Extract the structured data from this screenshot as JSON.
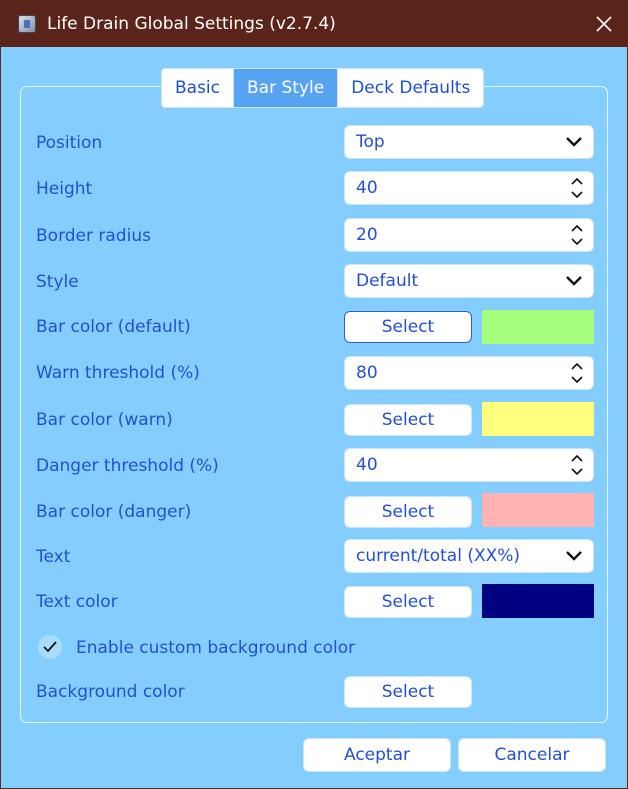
{
  "window": {
    "title": "Life Drain Global Settings (v2.7.4)",
    "icon": "app-icon",
    "close_icon": "close-icon",
    "titlebar_color": "#5b241b",
    "background_color": "#84ceff"
  },
  "tabs": [
    {
      "label": "Basic",
      "active": false
    },
    {
      "label": "Bar Style",
      "active": true
    },
    {
      "label": "Deck Defaults",
      "active": false
    }
  ],
  "form": {
    "position": {
      "label": "Position",
      "value": "Top"
    },
    "height": {
      "label": "Height",
      "value": "40"
    },
    "border_radius": {
      "label": "Border radius",
      "value": "20"
    },
    "style": {
      "label": "Style",
      "value": "Default"
    },
    "bar_color_default": {
      "label": "Bar color (default)",
      "button": "Select",
      "color": "#a6ff7d"
    },
    "warn_threshold": {
      "label": "Warn threshold (%)",
      "value": "80"
    },
    "bar_color_warn": {
      "label": "Bar color (warn)",
      "button": "Select",
      "color": "#ffff7d"
    },
    "danger_threshold": {
      "label": "Danger threshold (%)",
      "value": "40"
    },
    "bar_color_danger": {
      "label": "Bar color (danger)",
      "button": "Select",
      "color": "#ffb3b3"
    },
    "text": {
      "label": "Text",
      "value": "current/total (XX%)"
    },
    "text_color": {
      "label": "Text color",
      "button": "Select",
      "color": "#000080"
    },
    "custom_bg": {
      "label": "Enable custom background color",
      "checked": true
    },
    "background_color": {
      "label": "Background color",
      "button": "Select"
    }
  },
  "footer": {
    "ok": "Aceptar",
    "cancel": "Cancelar"
  }
}
